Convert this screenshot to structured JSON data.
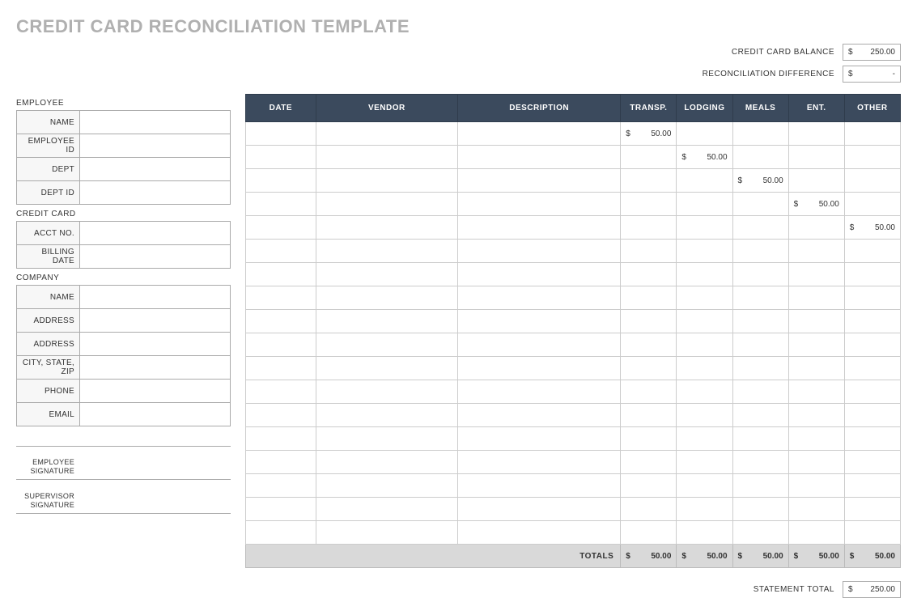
{
  "title": "CREDIT CARD RECONCILIATION TEMPLATE",
  "summary": {
    "balance_label": "CREDIT CARD BALANCE",
    "balance_currency": "$",
    "balance_value": "250.00",
    "diff_label": "RECONCILIATION DIFFERENCE",
    "diff_currency": "$",
    "diff_value": "-"
  },
  "sidebar": {
    "employee": {
      "header": "EMPLOYEE",
      "fields": [
        {
          "label": "NAME",
          "value": ""
        },
        {
          "label": "EMPLOYEE ID",
          "value": ""
        },
        {
          "label": "DEPT",
          "value": ""
        },
        {
          "label": "DEPT ID",
          "value": ""
        }
      ]
    },
    "creditcard": {
      "header": "CREDIT CARD",
      "fields": [
        {
          "label": "ACCT NO.",
          "value": ""
        },
        {
          "label": "BILLING DATE",
          "value": ""
        }
      ]
    },
    "company": {
      "header": "COMPANY",
      "fields": [
        {
          "label": "NAME",
          "value": ""
        },
        {
          "label": "ADDRESS",
          "value": ""
        },
        {
          "label": "ADDRESS",
          "value": ""
        },
        {
          "label": "CITY, STATE, ZIP",
          "value": ""
        },
        {
          "label": "PHONE",
          "value": ""
        },
        {
          "label": "EMAIL",
          "value": ""
        }
      ]
    },
    "signatures": {
      "employee": "EMPLOYEE SIGNATURE",
      "supervisor": "SUPERVISOR SIGNATURE"
    }
  },
  "table": {
    "headers": [
      "DATE",
      "VENDOR",
      "DESCRIPTION",
      "TRANSP.",
      "LODGING",
      "MEALS",
      "ENT.",
      "OTHER"
    ],
    "rows": [
      {
        "date": "",
        "vendor": "",
        "desc": "",
        "transp": "50.00",
        "lodging": "",
        "meals": "",
        "ent": "",
        "other": ""
      },
      {
        "date": "",
        "vendor": "",
        "desc": "",
        "transp": "",
        "lodging": "50.00",
        "meals": "",
        "ent": "",
        "other": ""
      },
      {
        "date": "",
        "vendor": "",
        "desc": "",
        "transp": "",
        "lodging": "",
        "meals": "50.00",
        "ent": "",
        "other": ""
      },
      {
        "date": "",
        "vendor": "",
        "desc": "",
        "transp": "",
        "lodging": "",
        "meals": "",
        "ent": "50.00",
        "other": ""
      },
      {
        "date": "",
        "vendor": "",
        "desc": "",
        "transp": "",
        "lodging": "",
        "meals": "",
        "ent": "",
        "other": "50.00"
      },
      {
        "date": "",
        "vendor": "",
        "desc": "",
        "transp": "",
        "lodging": "",
        "meals": "",
        "ent": "",
        "other": ""
      },
      {
        "date": "",
        "vendor": "",
        "desc": "",
        "transp": "",
        "lodging": "",
        "meals": "",
        "ent": "",
        "other": ""
      },
      {
        "date": "",
        "vendor": "",
        "desc": "",
        "transp": "",
        "lodging": "",
        "meals": "",
        "ent": "",
        "other": ""
      },
      {
        "date": "",
        "vendor": "",
        "desc": "",
        "transp": "",
        "lodging": "",
        "meals": "",
        "ent": "",
        "other": ""
      },
      {
        "date": "",
        "vendor": "",
        "desc": "",
        "transp": "",
        "lodging": "",
        "meals": "",
        "ent": "",
        "other": ""
      },
      {
        "date": "",
        "vendor": "",
        "desc": "",
        "transp": "",
        "lodging": "",
        "meals": "",
        "ent": "",
        "other": ""
      },
      {
        "date": "",
        "vendor": "",
        "desc": "",
        "transp": "",
        "lodging": "",
        "meals": "",
        "ent": "",
        "other": ""
      },
      {
        "date": "",
        "vendor": "",
        "desc": "",
        "transp": "",
        "lodging": "",
        "meals": "",
        "ent": "",
        "other": ""
      },
      {
        "date": "",
        "vendor": "",
        "desc": "",
        "transp": "",
        "lodging": "",
        "meals": "",
        "ent": "",
        "other": ""
      },
      {
        "date": "",
        "vendor": "",
        "desc": "",
        "transp": "",
        "lodging": "",
        "meals": "",
        "ent": "",
        "other": ""
      },
      {
        "date": "",
        "vendor": "",
        "desc": "",
        "transp": "",
        "lodging": "",
        "meals": "",
        "ent": "",
        "other": ""
      },
      {
        "date": "",
        "vendor": "",
        "desc": "",
        "transp": "",
        "lodging": "",
        "meals": "",
        "ent": "",
        "other": ""
      },
      {
        "date": "",
        "vendor": "",
        "desc": "",
        "transp": "",
        "lodging": "",
        "meals": "",
        "ent": "",
        "other": ""
      }
    ],
    "totals_label": "TOTALS",
    "totals": {
      "transp": "50.00",
      "lodging": "50.00",
      "meals": "50.00",
      "ent": "50.00",
      "other": "50.00"
    },
    "currency": "$"
  },
  "footer": {
    "statement_total_label": "STATEMENT TOTAL",
    "statement_total_currency": "$",
    "statement_total_value": "250.00"
  }
}
